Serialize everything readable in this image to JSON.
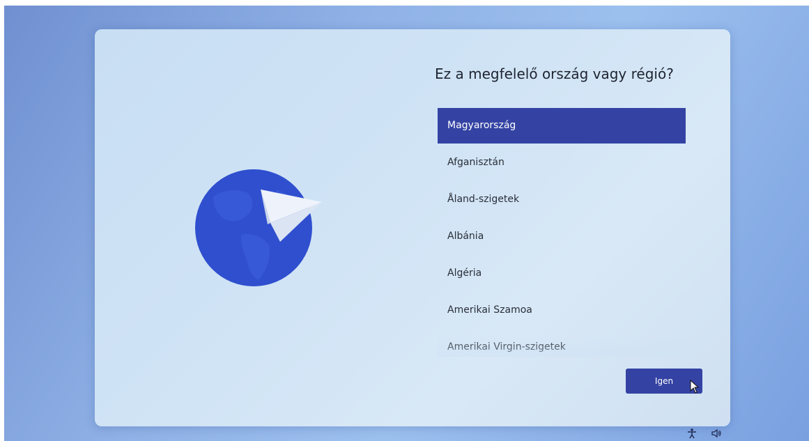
{
  "setup": {
    "title": "Ez a megfelelő ország vagy régió?",
    "countries": [
      {
        "label": "Magyarország",
        "selected": true
      },
      {
        "label": "Afganisztán",
        "selected": false
      },
      {
        "label": "Åland-szigetek",
        "selected": false
      },
      {
        "label": "Albánia",
        "selected": false
      },
      {
        "label": "Algéria",
        "selected": false
      },
      {
        "label": "Amerikai Szamoa",
        "selected": false
      },
      {
        "label": "Amerikai Virgin-szigetek",
        "selected": false
      }
    ],
    "confirm_label": "Igen"
  },
  "colors": {
    "accent": "#3443a3",
    "globe": "#2f4fcf",
    "card_background": "#cfe3f5"
  },
  "icons": {
    "illustration": "globe-with-paper-plane",
    "tray": [
      "accessibility-icon",
      "volume-icon"
    ],
    "pointer": "mouse-cursor"
  }
}
